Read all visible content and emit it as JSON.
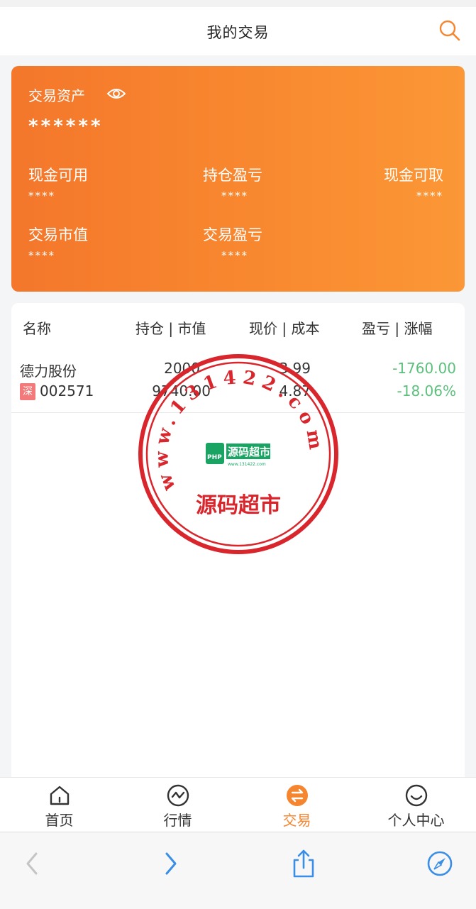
{
  "header": {
    "title": "我的交易"
  },
  "asset_card": {
    "label": "交易资产",
    "value": "******",
    "stats": [
      {
        "label": "现金可用",
        "value": "****"
      },
      {
        "label": "持仓盈亏",
        "value": "****"
      },
      {
        "label": "现金可取",
        "value": "****"
      },
      {
        "label": "交易市值",
        "value": "****"
      },
      {
        "label": "交易盈亏",
        "value": "****"
      }
    ]
  },
  "table": {
    "headers": [
      "名称",
      "持仓 | 市值",
      "现价 | 成本",
      "盈亏 | 涨幅"
    ],
    "rows": [
      {
        "name": "德力股份",
        "market": "深",
        "code": "002571",
        "position": "2000",
        "market_value": "9740.00",
        "price": "3.99",
        "cost": "4.87",
        "pnl": "-1760.00",
        "change": "-18.06%"
      }
    ]
  },
  "watermark": {
    "arc_text": "www.131422.com",
    "logo_text": "源码超市",
    "logo_small": "PHP",
    "logo_url": "www.131422.com",
    "bottom_text": "源码超市"
  },
  "tabbar": {
    "tabs": [
      {
        "label": "首页",
        "icon": "home-icon"
      },
      {
        "label": "行情",
        "icon": "chart-icon"
      },
      {
        "label": "交易",
        "icon": "trade-icon",
        "active": true
      },
      {
        "label": "个人中心",
        "icon": "user-icon"
      }
    ]
  },
  "colors": {
    "accent": "#f5852f",
    "card_start": "#f4772b",
    "card_end": "#fb9736",
    "loss_green": "#5cc07c",
    "badge_red": "#f27a7a",
    "browser_blue": "#3a8ee6",
    "stamp_red": "#d9262c"
  }
}
